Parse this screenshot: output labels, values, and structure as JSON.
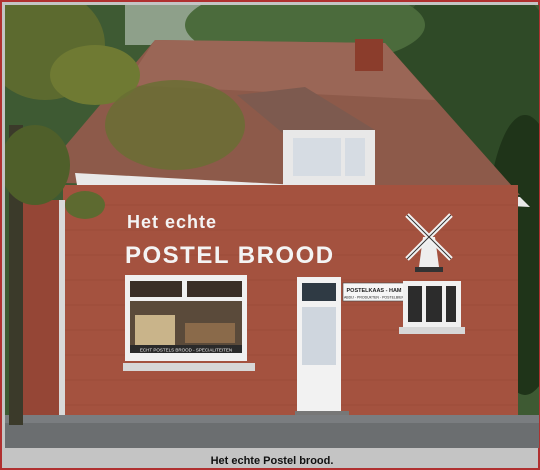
{
  "photo": {
    "facade_line1": "Het echte",
    "facade_line2": "POSTEL BROOD",
    "side_sign_line1": "POSTELKAAS - HAM",
    "side_sign_line2": "ABDIJ - PRODUKTEN - POSTELBIER",
    "window_sign": "ECHT POSTELS BROOD - SPECIALITEITEN",
    "icons": [
      "windmill-icon"
    ]
  },
  "caption": "Het echte Postel brood."
}
